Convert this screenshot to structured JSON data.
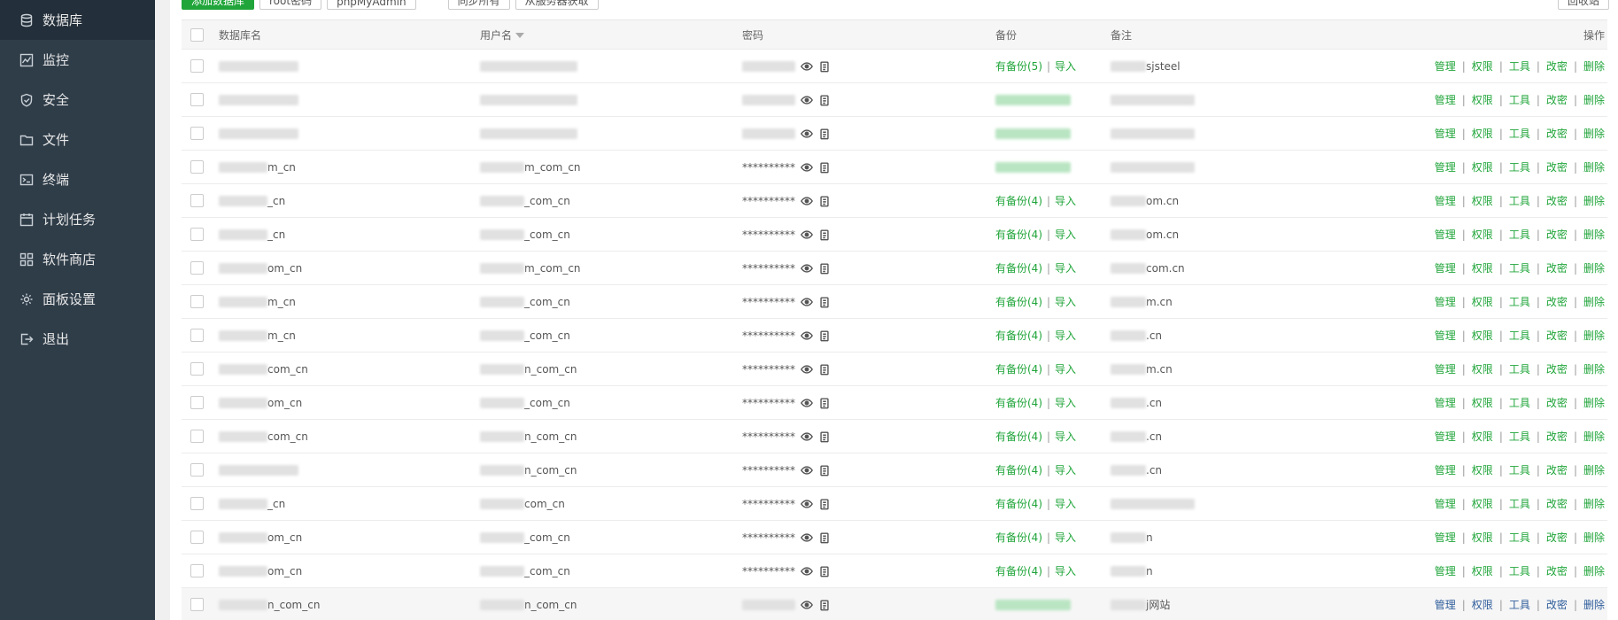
{
  "sidebar": {
    "items": [
      {
        "label": "数据库",
        "icon": "database-icon",
        "active": true
      },
      {
        "label": "监控",
        "icon": "monitor-icon"
      },
      {
        "label": "安全",
        "icon": "shield-icon"
      },
      {
        "label": "文件",
        "icon": "folder-icon"
      },
      {
        "label": "终端",
        "icon": "terminal-icon"
      },
      {
        "label": "计划任务",
        "icon": "calendar-icon"
      },
      {
        "label": "软件商店",
        "icon": "grid-icon"
      },
      {
        "label": "面板设置",
        "icon": "gear-icon"
      },
      {
        "label": "退出",
        "icon": "logout-icon"
      }
    ]
  },
  "toolbar": {
    "add_db": "添加数据库",
    "root_pw": "root密码",
    "phpmyadmin": "phpMyAdmin",
    "sync_all": "同步所有",
    "sync_from_server": "从服务器获取",
    "recycle": "回收站"
  },
  "table": {
    "headers": {
      "name": "数据库名",
      "user": "用户名",
      "password": "密码",
      "backup": "备份",
      "note": "备注",
      "ops": "操作"
    },
    "masked_password": "**********",
    "backup_link": "有备份(4)",
    "backup_link_first": "有备份(5)",
    "import_link": "导入",
    "ops": [
      "管理",
      "权限",
      "工具",
      "改密",
      "删除"
    ],
    "rows": [
      {
        "name": "",
        "user": "",
        "pw": false,
        "backup": "first",
        "note": "sjsteel"
      },
      {
        "name": "",
        "user": "",
        "pw": false,
        "backup": "blur",
        "note": ""
      },
      {
        "name": "",
        "user": "",
        "pw": false,
        "backup": "blur",
        "note": ""
      },
      {
        "name": "m_cn",
        "user": "m_com_cn",
        "pw": true,
        "backup": "blur",
        "note": ""
      },
      {
        "name": "_cn",
        "user": "_com_cn",
        "pw": true,
        "backup": "link",
        "note": "om.cn"
      },
      {
        "name": "_cn",
        "user": "_com_cn",
        "pw": true,
        "backup": "link",
        "note": "om.cn"
      },
      {
        "name": "om_cn",
        "user": "m_com_cn",
        "pw": true,
        "backup": "link",
        "note": "com.cn"
      },
      {
        "name": "m_cn",
        "user": "_com_cn",
        "pw": true,
        "backup": "link",
        "note": "m.cn"
      },
      {
        "name": "m_cn",
        "user": "_com_cn",
        "pw": true,
        "backup": "link",
        "note": ".cn"
      },
      {
        "name": "com_cn",
        "user": "n_com_cn",
        "pw": true,
        "backup": "link",
        "note": "m.cn"
      },
      {
        "name": "om_cn",
        "user": "_com_cn",
        "pw": true,
        "backup": "link",
        "note": ".cn"
      },
      {
        "name": "com_cn",
        "user": "n_com_cn",
        "pw": true,
        "backup": "link",
        "note": ".cn"
      },
      {
        "name": "",
        "user": "n_com_cn",
        "pw": true,
        "backup": "link",
        "note": ".cn"
      },
      {
        "name": "_cn",
        "user": "com_cn",
        "pw": true,
        "backup": "link",
        "note": ""
      },
      {
        "name": "om_cn",
        "user": "_com_cn",
        "pw": true,
        "backup": "link",
        "note": "n"
      },
      {
        "name": "om_cn",
        "user": "_com_cn",
        "pw": true,
        "backup": "link",
        "note": "n"
      },
      {
        "name": "n_com_cn",
        "user": "n_com_cn",
        "pw": false,
        "backup": "blur",
        "note": "j网站",
        "highlight": true
      }
    ]
  },
  "colors": {
    "sidebar_bg": "#2f3d49",
    "sidebar_active": "#232f3a",
    "accent_green": "#20a53a",
    "ops_navy": "#2e5d9b"
  }
}
